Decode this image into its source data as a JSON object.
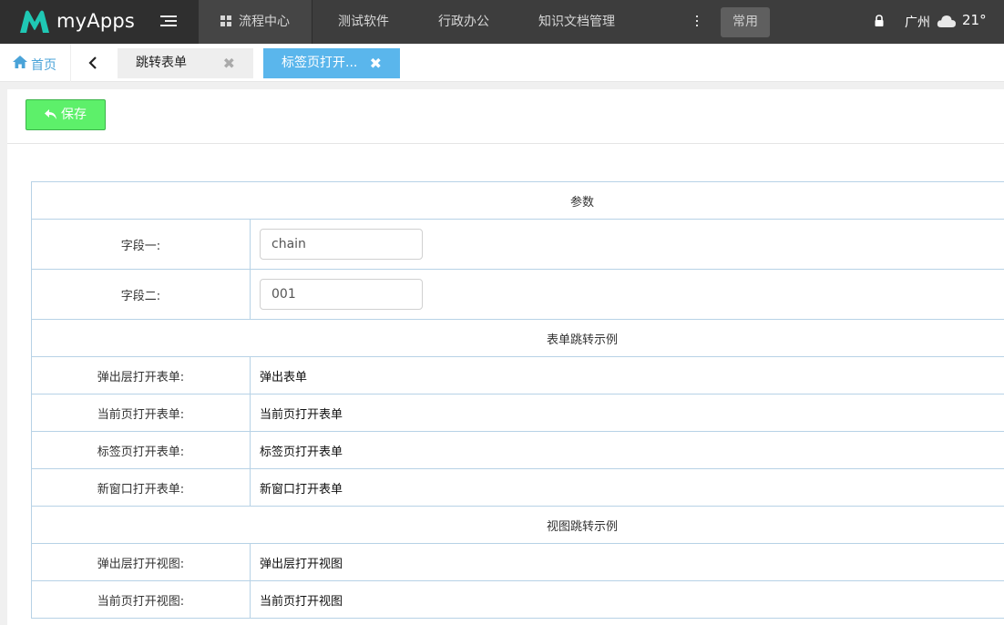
{
  "header": {
    "app_name": "myApps",
    "nav": [
      "流程中心",
      "测试软件",
      "行政办公",
      "知识文档管理"
    ],
    "common_label": "常用",
    "city": "广州",
    "temperature": "21°"
  },
  "tabs": {
    "home_label": "首页",
    "items": [
      {
        "label": "跳转表单",
        "active": false
      },
      {
        "label": "标签页打开...",
        "active": true
      }
    ],
    "close_glyph": "✖"
  },
  "toolbar": {
    "save_label": "保存"
  },
  "form": {
    "section_params": "参数",
    "fields": [
      {
        "label": "字段一:",
        "value": "chain"
      },
      {
        "label": "字段二:",
        "value": "001"
      }
    ],
    "section_form_jump": "表单跳转示例",
    "form_links": [
      {
        "label": "弹出层打开表单:",
        "link": "弹出表单"
      },
      {
        "label": "当前页打开表单:",
        "link": "当前页打开表单"
      },
      {
        "label": "标签页打开表单:",
        "link": "标签页打开表单"
      },
      {
        "label": "新窗口打开表单:",
        "link": "新窗口打开表单"
      }
    ],
    "section_view_jump": "视图跳转示例",
    "view_links": [
      {
        "label": "弹出层打开视图:",
        "link": "弹出层打开视图"
      },
      {
        "label": "当前页打开视图:",
        "link": "当前页打开视图"
      }
    ]
  },
  "icons": {
    "logo": "m-logo-icon",
    "menu": "menu-toggle-icon",
    "grid": "grid-icon",
    "more": "kebab-icon",
    "lock": "lock-icon",
    "weather": "cloud-icon",
    "home": "home-icon",
    "back": "chevron-left-icon",
    "save": "reply-arrow-icon"
  },
  "colors": {
    "topbar": "#3d3d3d",
    "logo_teal": "#1fc8b4",
    "active_tab": "#5ab6ec",
    "save_button": "#5df06a",
    "table_border": "#b7d2e6"
  }
}
